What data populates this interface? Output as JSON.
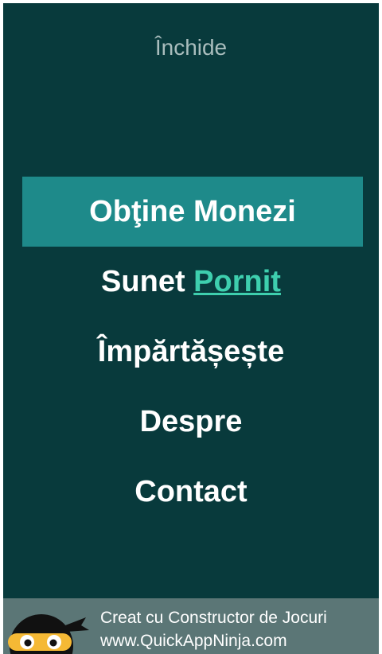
{
  "header": {
    "close_label": "Închide"
  },
  "menu": {
    "items": [
      {
        "label": "Obţine Monezi"
      },
      {
        "label": "Sunet",
        "value": "Pornit"
      },
      {
        "label": "Împărtășește"
      },
      {
        "label": "Despre"
      },
      {
        "label": "Contact"
      }
    ]
  },
  "footer": {
    "line1": "Creat cu Constructor de Jocuri",
    "line2": "www.QuickAppNinja.com",
    "logo_icon": "ninja-mascot-icon"
  },
  "colors": {
    "background": "#083a3c",
    "highlight": "#1e8a8a",
    "toggle_accent": "#3ecfae",
    "footer": "#5b7676",
    "close_text": "#a9bdbd"
  }
}
